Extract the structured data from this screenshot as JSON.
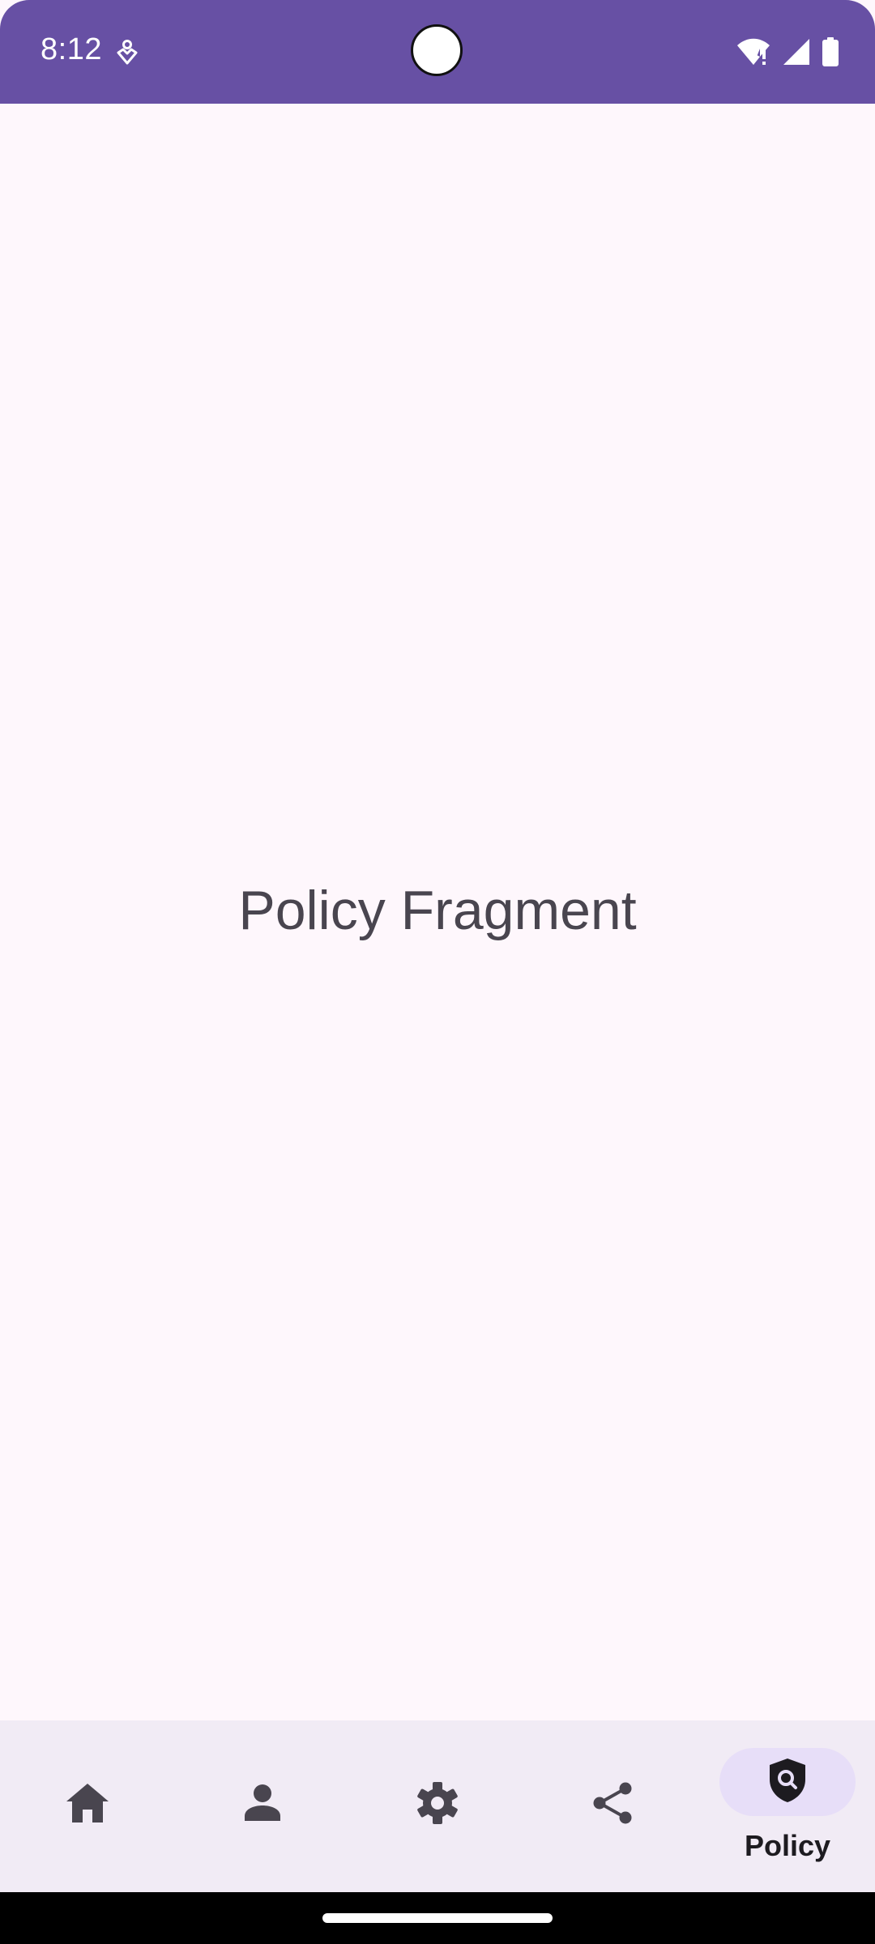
{
  "status_bar": {
    "time": "8:12",
    "background_color": "#6750A4",
    "icons": [
      "notification-icon",
      "wifi-alert-icon",
      "signal-icon",
      "battery-icon"
    ]
  },
  "content": {
    "text": "Policy Fragment"
  },
  "bottom_nav": {
    "items": [
      {
        "icon": "home-icon",
        "label": "",
        "selected": false
      },
      {
        "icon": "person-icon",
        "label": "",
        "selected": false
      },
      {
        "icon": "gear-icon",
        "label": "",
        "selected": false
      },
      {
        "icon": "share-icon",
        "label": "",
        "selected": false
      },
      {
        "icon": "shield-search-icon",
        "label": "Policy",
        "selected": true
      }
    ],
    "background_color": "#F1EBF5",
    "active_indicator_color": "#E7DEF8"
  }
}
